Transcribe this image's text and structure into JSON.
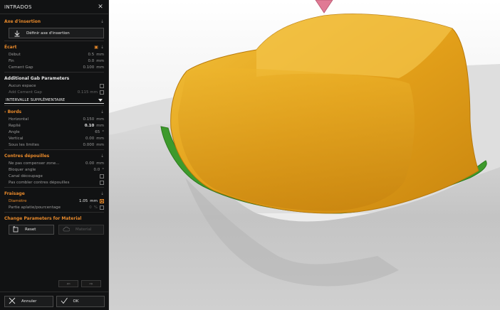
{
  "window": {
    "title": "INTRADOS"
  },
  "axis": {
    "header": "Axe d'insertion",
    "define_button": "Définir axe d'insertion"
  },
  "gap": {
    "header": "Écart",
    "rows": [
      {
        "label": "Début",
        "value": "0.5",
        "unit": "mm"
      },
      {
        "label": "Fin",
        "value": "0.0",
        "unit": "mm"
      },
      {
        "label": "Cement Gap",
        "value": "0.100",
        "unit": "mm"
      }
    ]
  },
  "additional": {
    "header": "Additional Gab Parameters",
    "rows": [
      {
        "label": "Aucun espace",
        "value": ""
      },
      {
        "label": "Add Cement Gap",
        "value": "0.115 mm"
      }
    ]
  },
  "extra_interval": {
    "label": "INTERVALLE SUPPLÉMENTAIRE"
  },
  "edges": {
    "header": "Bords",
    "rows": [
      {
        "label": "Horizontal",
        "value": "0.150",
        "unit": "mm"
      },
      {
        "label": "Replié",
        "value": "0.10",
        "unit": "mm"
      },
      {
        "label": "Angle",
        "value": "65",
        "unit": "°"
      },
      {
        "label": "Vertical",
        "value": "0.00",
        "unit": "mm"
      },
      {
        "label": "Sous les limites",
        "value": "0.000",
        "unit": "mm"
      }
    ]
  },
  "undercuts": {
    "header": "Contres dépouilles",
    "rows": [
      {
        "label": "Ne pas compenser zone...",
        "value": "0.00",
        "unit": "mm"
      },
      {
        "label": "Bloquer angle",
        "value": "0.0",
        "unit": "°"
      },
      {
        "label": "Canal découpage",
        "value": ""
      },
      {
        "label": "Pas combler contres dépouilles",
        "value": ""
      }
    ]
  },
  "milling": {
    "header": "Fraisage",
    "rows": [
      {
        "label": "Diamètre",
        "value": "1.05",
        "unit": "mm"
      },
      {
        "label": "Partie aplatie/pourcentage",
        "value": "0",
        "unit": "%"
      }
    ]
  },
  "material": {
    "header": "Change Parameters for Material",
    "reset_label": "Reset",
    "material_label": "Material"
  },
  "footer": {
    "cancel_label": "Annuler",
    "ok_label": "OK"
  },
  "colors": {
    "accent": "#e98a2b",
    "panel_bg": "#111213",
    "crown": "#e8a51f",
    "margin_line": "#3d9a2c"
  }
}
